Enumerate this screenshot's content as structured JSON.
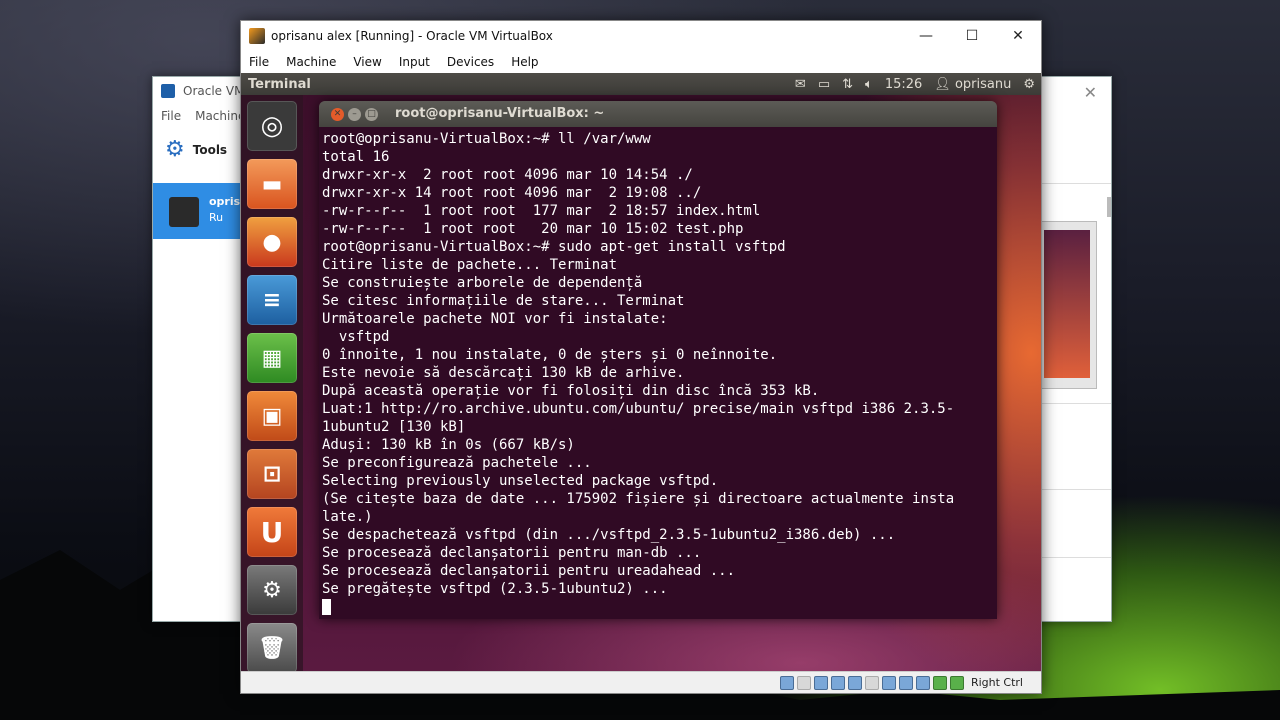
{
  "manager_window": {
    "title": "Oracle VM",
    "menu": [
      "File",
      "Machine"
    ],
    "tools_label": "Tools",
    "vm_name": "oprisa",
    "vm_state": "Ru"
  },
  "vm_window": {
    "title": "oprisanu alex [Running] - Oracle VM VirtualBox",
    "menu": [
      "File",
      "Machine",
      "View",
      "Input",
      "Devices",
      "Help"
    ],
    "host_key": "Right Ctrl"
  },
  "guest_panel": {
    "app_title": "Terminal",
    "time": "15:26",
    "user": "oprisanu"
  },
  "launcher": {
    "items": [
      "dash-home",
      "files",
      "firefox",
      "libreoffice-writer",
      "libreoffice-calc",
      "libreoffice-impress",
      "ubuntu-software-center",
      "ubuntu-one",
      "system-settings",
      "trash"
    ]
  },
  "terminal": {
    "title": "root@oprisanu-VirtualBox: ~",
    "lines": [
      "root@oprisanu-VirtualBox:~# ll /var/www",
      "total 16",
      "drwxr-xr-x  2 root root 4096 mar 10 14:54 ./",
      "drwxr-xr-x 14 root root 4096 mar  2 19:08 ../",
      "-rw-r--r--  1 root root  177 mar  2 18:57 index.html",
      "-rw-r--r--  1 root root   20 mar 10 15:02 test.php",
      "root@oprisanu-VirtualBox:~# sudo apt-get install vsftpd",
      "Citire liste de pachete... Terminat",
      "Se construiește arborele de dependență",
      "Se citesc informațiile de stare... Terminat",
      "Următoarele pachete NOI vor fi instalate:",
      "  vsftpd",
      "0 înnoite, 1 nou instalate, 0 de șters și 0 neînnoite.",
      "Este nevoie să descărcați 130 kB de arhive.",
      "După această operație vor fi folosiți din disc încă 353 kB.",
      "Luat:1 http://ro.archive.ubuntu.com/ubuntu/ precise/main vsftpd i386 2.3.5-",
      "1ubuntu2 [130 kB]",
      "Aduși: 130 kB în 0s (667 kB/s)",
      "Se preconfigurează pachetele ...",
      "Selecting previously unselected package vsftpd.",
      "(Se citește baza de date ... 175902 fișiere și directoare actualmente insta",
      "late.)",
      "Se despachetează vsftpd (din .../vsftpd_2.3.5-1ubuntu2_i386.deb) ...",
      "Se procesează declanșatorii pentru man-db ...",
      "Se procesează declanșatorii pentru ureadahead ...",
      "Se pregătește vsftpd (2.3.5-1ubuntu2) ..."
    ]
  },
  "colors": {
    "terminal_bg": "#300a24",
    "ubuntu_orange": "#e45b2a",
    "vbox_selection": "#2f8de4"
  }
}
